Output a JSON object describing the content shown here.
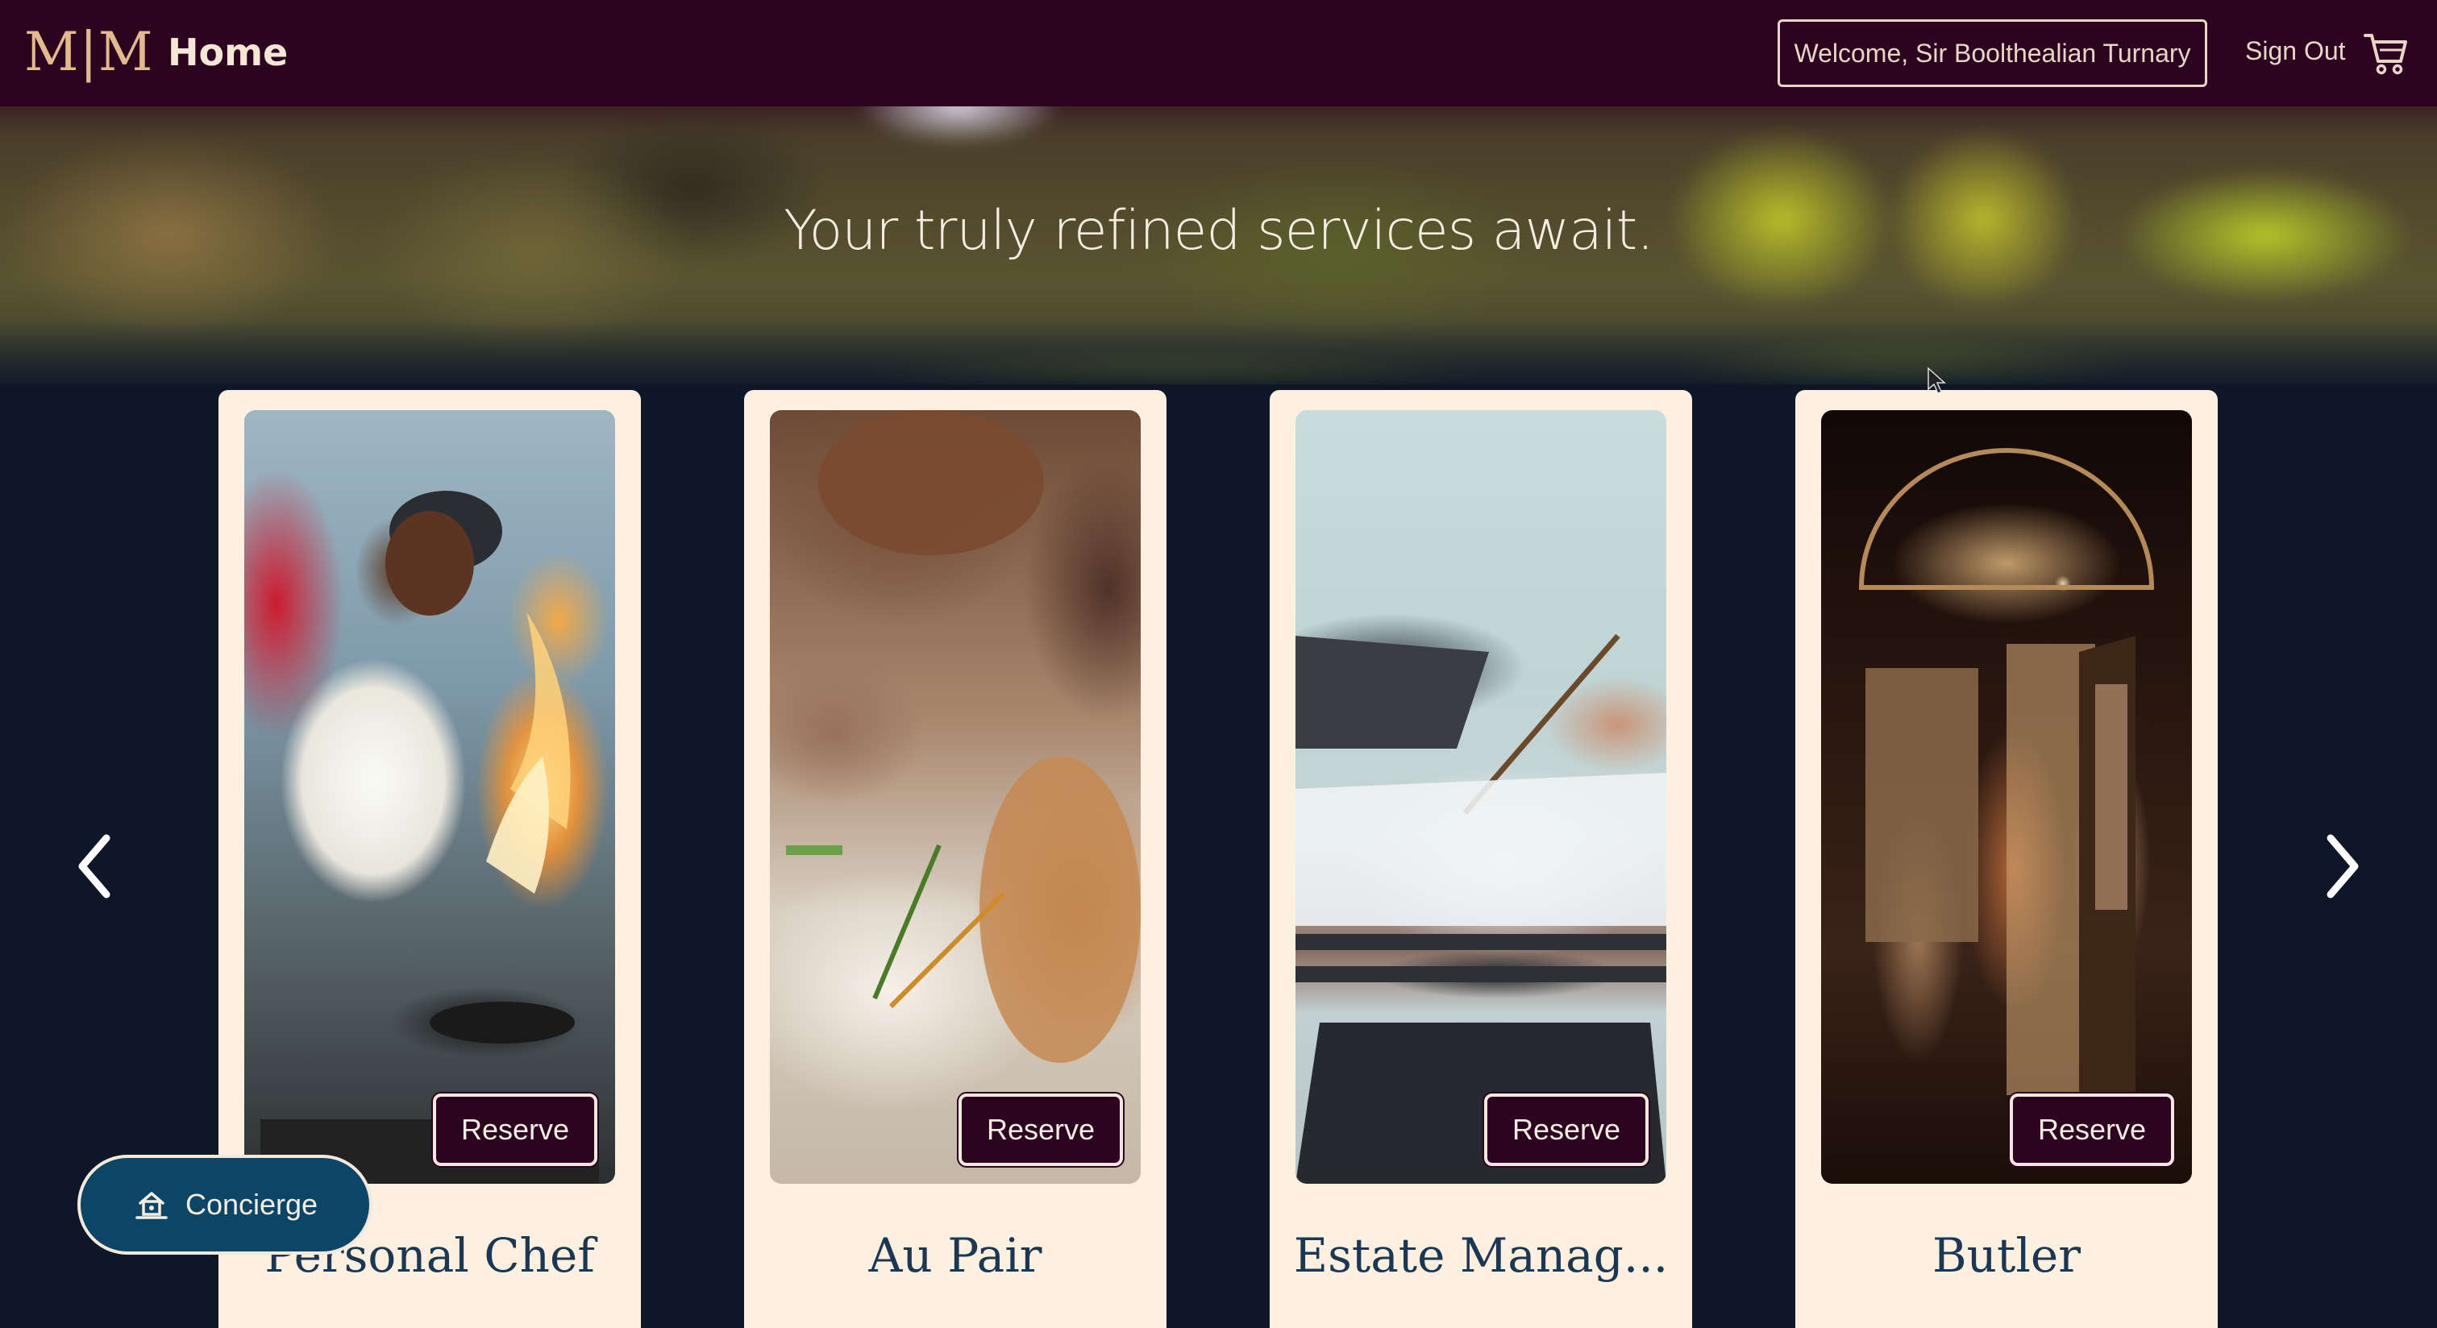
{
  "header": {
    "logo": "M|M",
    "home_label": "Home",
    "welcome_text": "Welcome, Sir Boolthealian Turnary",
    "sign_out_label": "Sign Out",
    "cart_icon": "cart-icon"
  },
  "hero": {
    "tagline": "Your truly refined services await."
  },
  "carousel": {
    "prev_icon": "chevron-left-icon",
    "next_icon": "chevron-right-icon",
    "cards": [
      {
        "title": "Personal Chef",
        "button": "Reserve"
      },
      {
        "title": "Au Pair",
        "button": "Reserve"
      },
      {
        "title": "Estate Manag...",
        "button": "Reserve"
      },
      {
        "title": "Butler",
        "button": "Reserve"
      }
    ]
  },
  "concierge": {
    "label": "Concierge",
    "icon": "concierge-icon"
  },
  "colors": {
    "header_bg": "#2c0420",
    "page_bg": "#0d1728",
    "card_bg": "#fdf0e1",
    "title_color": "#1b3752",
    "button_bg": "#2c0420",
    "concierge_bg": "#0c4565",
    "logo_color": "#e3b98e"
  }
}
